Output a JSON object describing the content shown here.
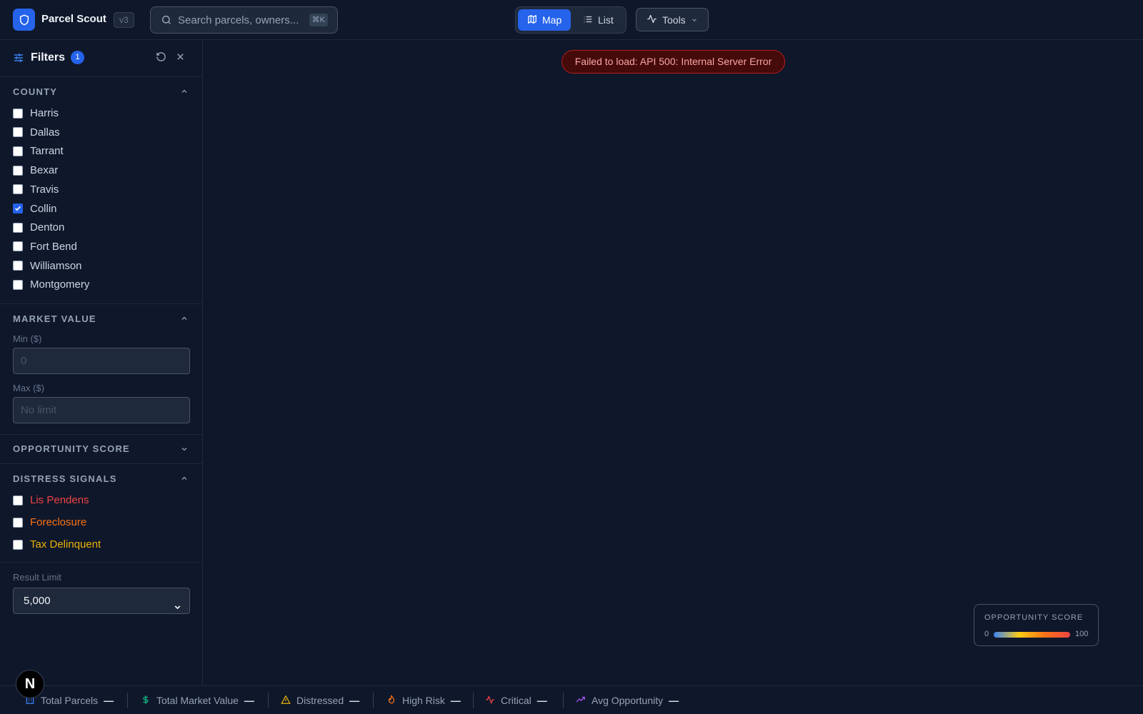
{
  "app": {
    "title": "Parcel Scout",
    "version": "v3"
  },
  "search": {
    "placeholder": "Search parcels, owners...",
    "shortcut": "⌘K"
  },
  "view_toggle": {
    "map_label": "Map",
    "list_label": "List",
    "active": "Map"
  },
  "tools": {
    "label": "Tools"
  },
  "filters": {
    "title": "Filters",
    "active_count": "1",
    "county": {
      "title": "COUNTY",
      "items": [
        {
          "label": "Harris",
          "checked": false
        },
        {
          "label": "Dallas",
          "checked": false
        },
        {
          "label": "Tarrant",
          "checked": false
        },
        {
          "label": "Bexar",
          "checked": false
        },
        {
          "label": "Travis",
          "checked": false
        },
        {
          "label": "Collin",
          "checked": true
        },
        {
          "label": "Denton",
          "checked": false
        },
        {
          "label": "Fort Bend",
          "checked": false
        },
        {
          "label": "Williamson",
          "checked": false
        },
        {
          "label": "Montgomery",
          "checked": false
        }
      ]
    },
    "market_value": {
      "title": "MARKET VALUE",
      "min_label": "Min ($)",
      "min_placeholder": "0",
      "max_label": "Max ($)",
      "max_placeholder": "No limit"
    },
    "opportunity_score": {
      "title": "OPPORTUNITY SCORE"
    },
    "distress_signals": {
      "title": "DISTRESS SIGNALS",
      "items": [
        {
          "label": "Lis Pendens",
          "color": "#ef4444",
          "checked": false
        },
        {
          "label": "Foreclosure",
          "color": "#f97316",
          "checked": false
        },
        {
          "label": "Tax Delinquent",
          "color": "#eab308",
          "checked": false
        }
      ]
    },
    "result_limit": {
      "label": "Result Limit",
      "value": "5,000"
    }
  },
  "error": {
    "message": "Failed to load: API 500: Internal Server Error"
  },
  "legend": {
    "title": "OPPORTUNITY SCORE",
    "min": "0",
    "max": "100"
  },
  "status": {
    "items": [
      {
        "label": "Total Parcels",
        "icon": "building-icon",
        "color": "#3b82f6",
        "value": "—"
      },
      {
        "label": "Total Market Value",
        "icon": "dollar-icon",
        "color": "#10b981",
        "value": "—"
      },
      {
        "label": "Distressed",
        "icon": "warning-icon",
        "color": "#eab308",
        "value": "—"
      },
      {
        "label": "High Risk",
        "icon": "flame-icon",
        "color": "#f97316",
        "value": "—"
      },
      {
        "label": "Critical",
        "icon": "activity-icon",
        "color": "#ef4444",
        "value": "—"
      },
      {
        "label": "Avg Opportunity",
        "icon": "trending-up-icon",
        "color": "#a855f7",
        "value": "—"
      }
    ]
  },
  "dev_badge": "N"
}
